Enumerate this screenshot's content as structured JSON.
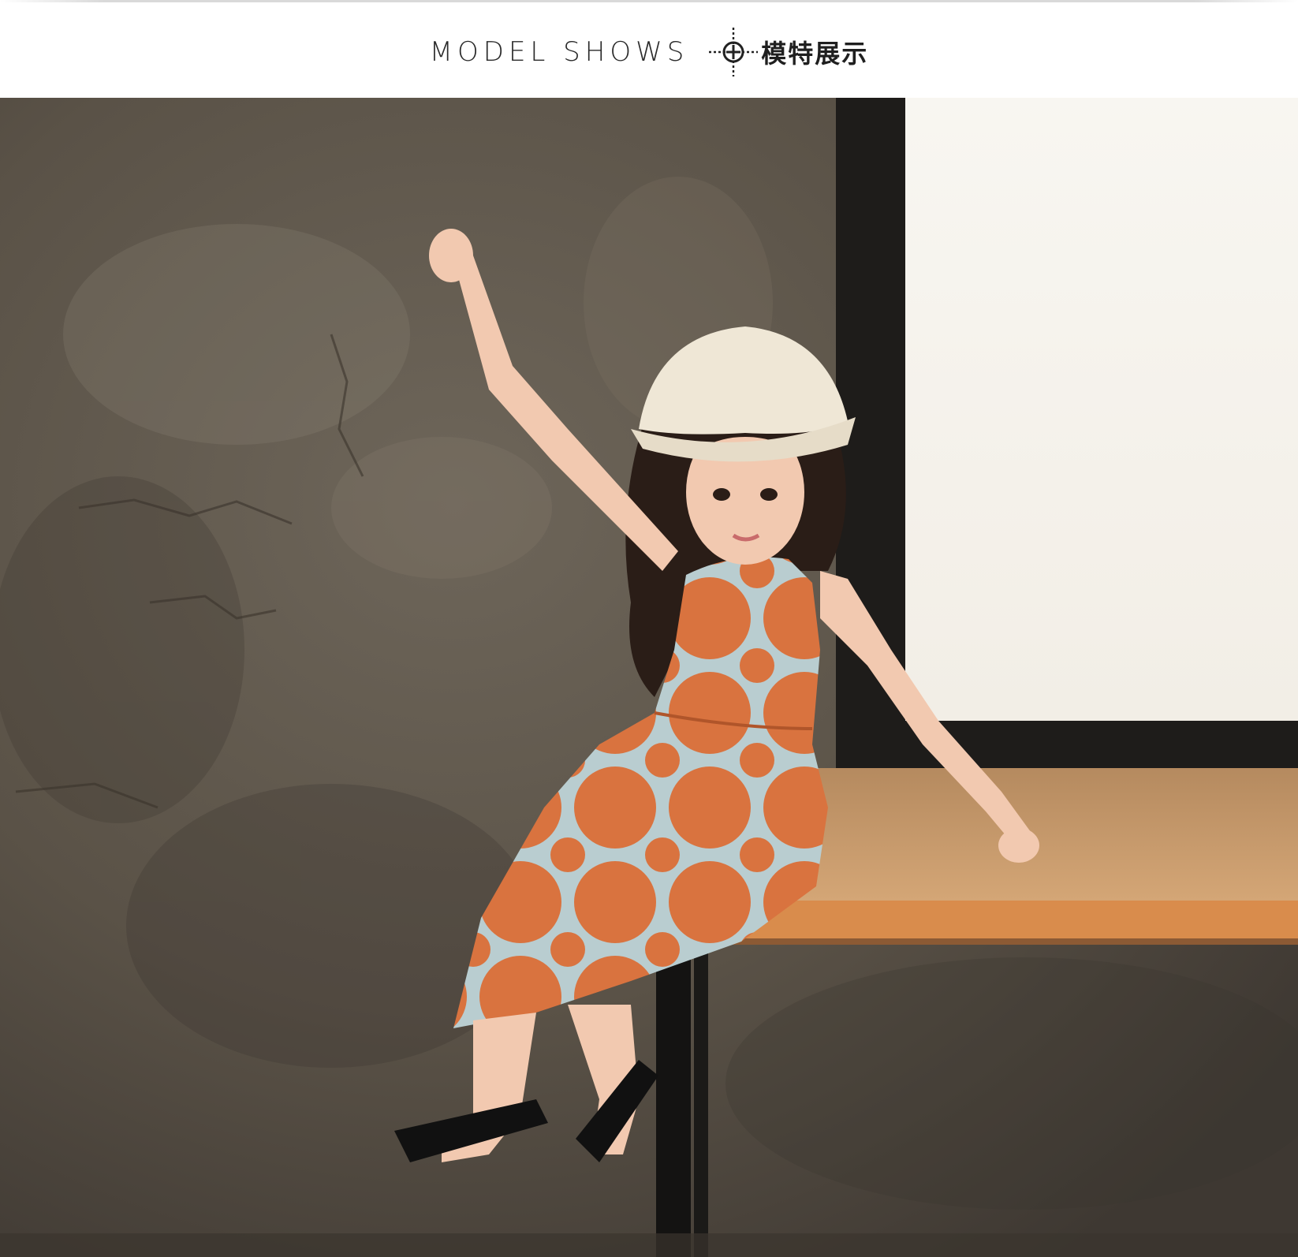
{
  "header": {
    "title_en": "MODEL SHOWS",
    "title_zh": "模特展示",
    "divider_icon": "crosshair-circle-icon"
  },
  "colors": {
    "wall": "#5d554a",
    "window_frame": "#1e1c1a",
    "window_glass": "#f7f4ee",
    "table_top": "#c89968",
    "table_edge": "#d98c4c",
    "dress_orange": "#d9733f",
    "dress_ground": "#b9cdd0",
    "hat": "#efe7d6",
    "hair": "#2a1d17",
    "skin": "#f2c9b0"
  }
}
